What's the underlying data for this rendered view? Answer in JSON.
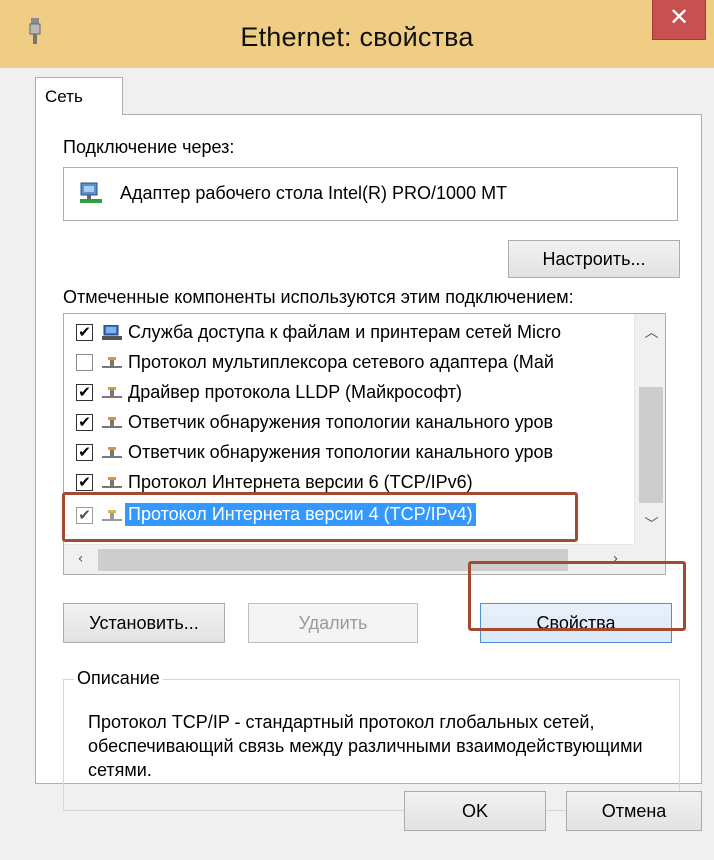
{
  "window": {
    "title": "Ethernet: свойства",
    "close_label": "✕"
  },
  "tabs": [
    {
      "label": "Сеть"
    }
  ],
  "connect_using": {
    "label": "Подключение через:",
    "adapter": "Адаптер рабочего стола Intel(R) PRO/1000 MT"
  },
  "configure_button": "Настроить...",
  "components": {
    "label": "Отмеченные компоненты используются этим подключением:",
    "items": [
      {
        "text": "Служба доступа к файлам и принтерам сетей Micro",
        "checked": true,
        "icon": "service-icon"
      },
      {
        "text": "Протокол мультиплексора сетевого адаптера (Май",
        "checked": false,
        "icon": "protocol-icon"
      },
      {
        "text": "Драйвер протокола LLDP (Майкрософт)",
        "checked": true,
        "icon": "protocol-icon"
      },
      {
        "text": "Ответчик обнаружения топологии канального уров",
        "checked": true,
        "icon": "protocol-icon"
      },
      {
        "text": "Ответчик обнаружения топологии канального уров",
        "checked": true,
        "icon": "protocol-icon"
      },
      {
        "text": "Протокол Интернета версии 6 (TCP/IPv6)",
        "checked": true,
        "icon": "protocol-icon"
      },
      {
        "text": "Протокол Интернета версии 4 (TCP/IPv4)",
        "checked": true,
        "icon": "protocol-icon",
        "selected": true
      }
    ]
  },
  "buttons": {
    "install": "Установить...",
    "uninstall": "Удалить",
    "properties": "Свойства",
    "ok": "OK",
    "cancel": "Отмена"
  },
  "description": {
    "legend": "Описание",
    "text": "Протокол TCP/IP - стандартный протокол глобальных сетей, обеспечивающий связь между различными взаимодействующими сетями."
  },
  "colors": {
    "titlebar": "#f0cd84",
    "close": "#c75050",
    "selection": "#3399ff",
    "highlight_frame": "#a44a30"
  }
}
